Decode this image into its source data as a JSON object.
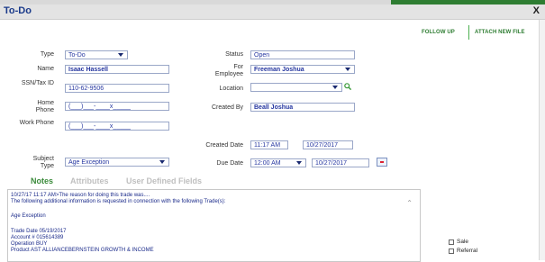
{
  "window": {
    "title": "To-Do",
    "close_label": "X"
  },
  "actions": {
    "follow_up": "FOLLOW UP",
    "attach_new_file": "ATTACH NEW FILE"
  },
  "form": {
    "type": {
      "label": "Type",
      "value": "To-Do"
    },
    "name": {
      "label": "Name",
      "value": "Isaac Hassell"
    },
    "ssn": {
      "label": "SSN/Tax ID",
      "value": "110-62-9506"
    },
    "home_phone": {
      "label": "Home Phone",
      "value": "(___)___-____x_____"
    },
    "work_phone": {
      "label": "Work Phone",
      "value": "(___)___-____x_____"
    },
    "subject_type": {
      "label": "Subject Type",
      "value": "Age Exception"
    },
    "status": {
      "label": "Status",
      "value": "Open"
    },
    "for_employee": {
      "label": "For Employee",
      "value": "Freeman Joshua"
    },
    "location": {
      "label": "Location",
      "value": ""
    },
    "created_by": {
      "label": "Created By",
      "value": "Beall Joshua"
    },
    "created_date": {
      "label": "Created Date",
      "time": "11:17 AM",
      "date": "10/27/2017"
    },
    "due_date": {
      "label": "Due Date",
      "time": "12:00 AM",
      "date": "10/27/2017"
    }
  },
  "tabs": [
    {
      "label": "Notes",
      "active": true
    },
    {
      "label": "Attributes",
      "active": false
    },
    {
      "label": "User Defined Fields",
      "active": false
    }
  ],
  "notes": {
    "lines": [
      "10/27/17 11:17 AM>The reason for doing this trade was....",
      "The following additional information is requested in connection with the following Trade(s):",
      "",
      "Age Exception",
      "",
      "Trade Date 05/19/2017",
      "Account #  015614389",
      "Operation  BUY",
      "Product    AST ALLIANCEBERNSTEIN GROWTH & INCOME"
    ]
  },
  "checkboxes": [
    {
      "label": "Sale",
      "checked": false
    },
    {
      "label": "Referral",
      "checked": false
    }
  ],
  "colors": {
    "accent_green": "#2e7d32",
    "title_blue": "#1a3a8a",
    "field_text": "#2536a0"
  }
}
